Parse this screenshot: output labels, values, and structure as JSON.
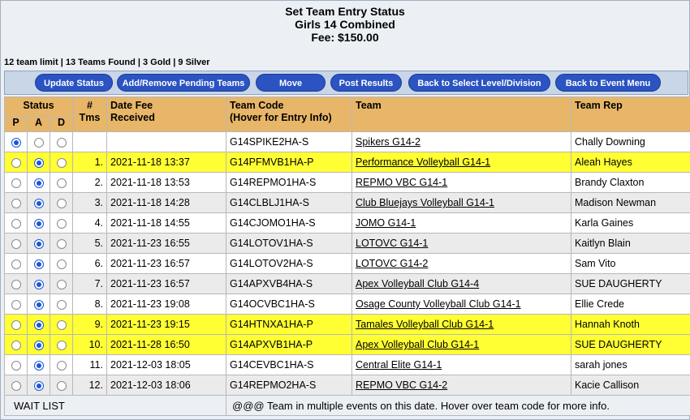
{
  "header": {
    "title": "Set Team Entry Status",
    "division": "Girls 14 Combined",
    "fee": "Fee: $150.00"
  },
  "summary": "12 team limit | 13 Teams Found | 3 Gold | 9 Silver",
  "toolbar": {
    "buttons": [
      "Update Status",
      "Add/Remove Pending Teams",
      "Move",
      "Post Results",
      "Back to Select Level/Division",
      "Back to Event Menu"
    ]
  },
  "table": {
    "headers": {
      "status": "Status",
      "p": "P",
      "a": "A",
      "d": "D",
      "tms_1": "#",
      "tms_2": "Tms",
      "date_1": "Date Fee",
      "date_2": "Received",
      "code_1": "Team Code",
      "code_2": "(Hover for Entry Info)",
      "team": "Team",
      "rep": "Team Rep"
    },
    "rows": [
      {
        "status": "P",
        "num": "",
        "date": "",
        "code": "G14SPIKE2HA-S",
        "team": "Spikers G14-2",
        "rep": "Chally Downing",
        "hl": "white"
      },
      {
        "status": "A",
        "num": "1.",
        "date": "2021-11-18 13:37",
        "code": "G14PFMVB1HA-P",
        "team": "Performance Volleyball G14-1",
        "rep": "Aleah Hayes",
        "hl": "yellow"
      },
      {
        "status": "A",
        "num": "2.",
        "date": "2021-11-18 13:53",
        "code": "G14REPMO1HA-S",
        "team": "REPMO VBC G14-1",
        "rep": "Brandy Claxton",
        "hl": "white"
      },
      {
        "status": "A",
        "num": "3.",
        "date": "2021-11-18 14:28",
        "code": "G14CLBLJ1HA-S",
        "team": "Club Bluejays Volleyball G14-1",
        "rep": "Madison Newman",
        "hl": "gray"
      },
      {
        "status": "A",
        "num": "4.",
        "date": "2021-11-18 14:55",
        "code": "G14CJOMO1HA-S",
        "team": "JOMO G14-1",
        "rep": "Karla Gaines",
        "hl": "white"
      },
      {
        "status": "A",
        "num": "5.",
        "date": "2021-11-23 16:55",
        "code": "G14LOTOV1HA-S",
        "team": "LOTOVC G14-1",
        "rep": "Kaitlyn Blain",
        "hl": "gray"
      },
      {
        "status": "A",
        "num": "6.",
        "date": "2021-11-23 16:57",
        "code": "G14LOTOV2HA-S",
        "team": "LOTOVC G14-2",
        "rep": "Sam Vito",
        "hl": "white"
      },
      {
        "status": "A",
        "num": "7.",
        "date": "2021-11-23 16:57",
        "code": "G14APXVB4HA-S",
        "team": "Apex Volleyball Club G14-4",
        "rep": "SUE DAUGHERTY",
        "hl": "gray"
      },
      {
        "status": "A",
        "num": "8.",
        "date": "2021-11-23 19:08",
        "code": "G14OCVBC1HA-S",
        "team": "Osage County Volleyball Club G14-1",
        "rep": "Ellie Crede",
        "hl": "white"
      },
      {
        "status": "A",
        "num": "9.",
        "date": "2021-11-23 19:15",
        "code": "G14HTNXA1HA-P",
        "team": "Tamales Volleyball Club G14-1",
        "rep": "Hannah Knoth",
        "hl": "yellow"
      },
      {
        "status": "A",
        "num": "10.",
        "date": "2021-11-28 16:50",
        "code": "G14APXVB1HA-P",
        "team": "Apex Volleyball Club G14-1",
        "rep": "SUE DAUGHERTY",
        "hl": "yellow"
      },
      {
        "status": "A",
        "num": "11.",
        "date": "2021-12-03 18:05",
        "code": "G14CEVBC1HA-S",
        "team": "Central Elite G14-1",
        "rep": "sarah jones",
        "hl": "white"
      },
      {
        "status": "A",
        "num": "12.",
        "date": "2021-12-03 18:06",
        "code": "G14REPMO2HA-S",
        "team": "REPMO VBC G14-2",
        "rep": "Kacie Callison",
        "hl": "gray"
      }
    ],
    "wait_list": "WAIT LIST",
    "footer_note": "@@@ Team in multiple events on this date.  Hover over team code for more info."
  }
}
